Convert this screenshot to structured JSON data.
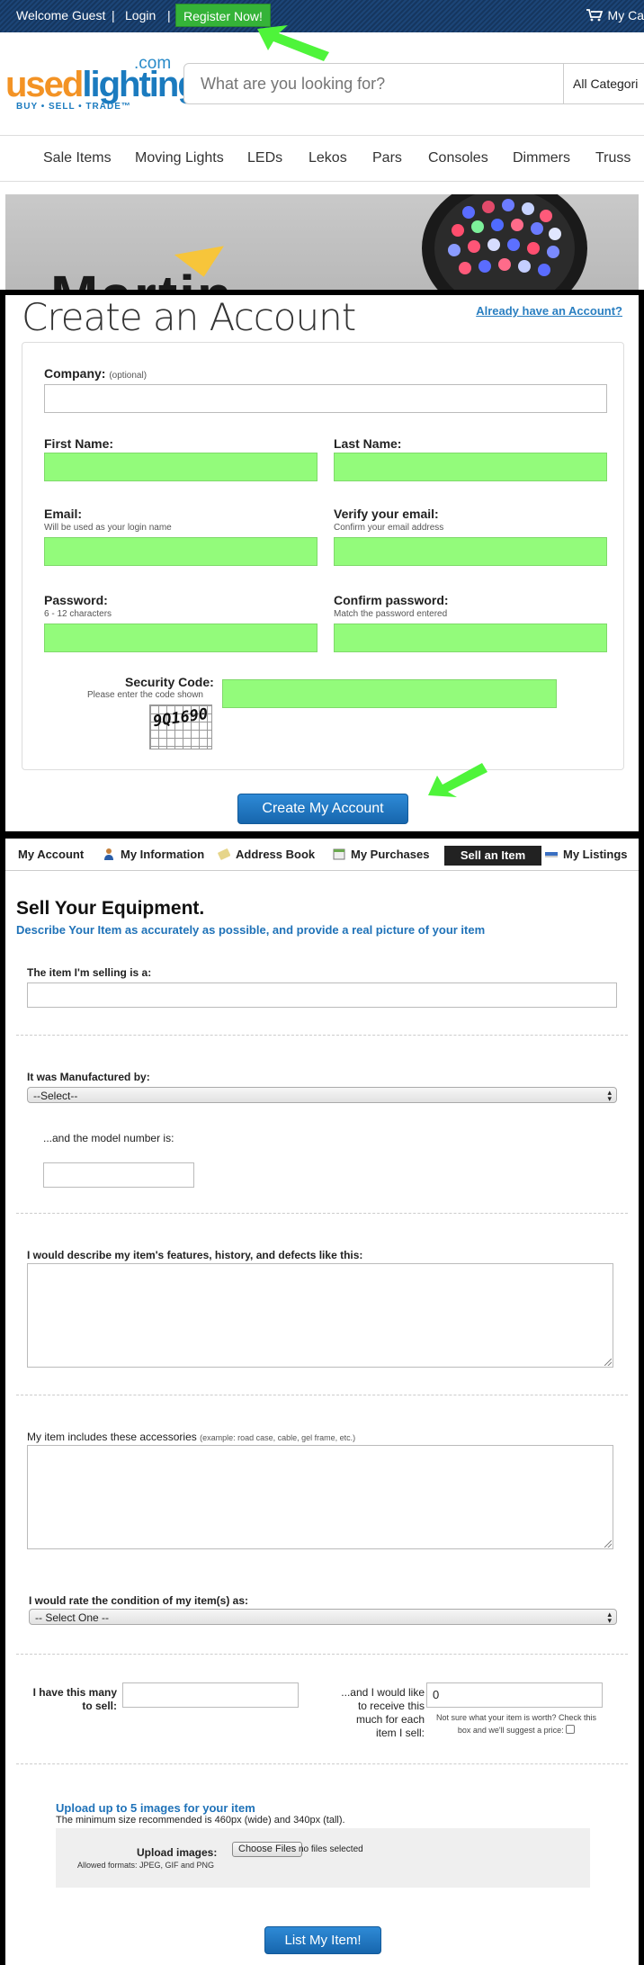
{
  "topbar": {
    "welcome": "Welcome Guest",
    "sep1": "|",
    "login": "Login",
    "sep2": "|",
    "register": "Register Now!",
    "cart": "My Ca"
  },
  "logo": {
    "word1": "used",
    "word2": "lighting",
    "dotcom": ".com",
    "tagline": "BUY • SELL • TRADE™"
  },
  "search": {
    "placeholder": "What are you looking for?",
    "category": "All Categori"
  },
  "nav": {
    "items": [
      "Sale Items",
      "Moving Lights",
      "LEDs",
      "Lekos",
      "Pars",
      "Consoles",
      "Dimmers",
      "Truss"
    ]
  },
  "hero": {
    "brand": "Martin"
  },
  "create_account": {
    "title": "Create an Account",
    "already_link": "Already have an Account?",
    "company_label": "Company:",
    "company_optional": "(optional)",
    "first_name_label": "First Name:",
    "last_name_label": "Last Name:",
    "email_label": "Email:",
    "email_sub": "Will be used as your login name",
    "verify_email_label": "Verify your email:",
    "verify_email_sub": "Confirm your email address",
    "password_label": "Password:",
    "password_sub": "6 - 12 characters",
    "confirm_password_label": "Confirm password:",
    "confirm_password_sub": "Match the password entered",
    "security_label": "Security Code:",
    "security_sub": "Please enter the code shown",
    "captcha": "9Q1690",
    "submit": "Create My Account",
    "highlight_color": "#93fb7b"
  },
  "account_nav": {
    "my_account": "My Account",
    "my_information": "My Information",
    "address_book": "Address Book",
    "my_purchases": "My Purchases",
    "sell_an_item": "Sell an Item",
    "my_listings": "My Listings"
  },
  "sell": {
    "title": "Sell Your Equipment.",
    "subtitle": "Describe Your Item as accurately as possible, and provide a real picture of your item",
    "item_label": "The item I'm selling is a:",
    "manufacturer_label": "It was Manufactured by:",
    "manufacturer_selected": "--Select--",
    "model_label": "...and the model number is:",
    "describe_label": "I would describe my item's features, history, and defects like this:",
    "accessories_label": "My item includes these accessories",
    "accessories_example": "(example: road case, cable, gel frame, etc.)",
    "condition_label": "I would rate the condition of my item(s) as:",
    "condition_selected": "-- Select One --",
    "quantity_label_1": "I have this many",
    "quantity_label_2": "to sell:",
    "price_label_1": "...and I would like",
    "price_label_2": "to receive this",
    "price_label_3": "much for each",
    "price_label_4": "item I sell:",
    "price_value": "0",
    "price_note_1": "Not sure what your item is worth? Check this",
    "price_note_2": "box and we'll suggest a price:",
    "upload_title": "Upload up to 5 images for your item",
    "upload_sub": "The minimum size recommended is 460px (wide) and 340px (tall).",
    "upload_label": "Upload images:",
    "upload_formats": "Allowed formats: JPEG, GIF and PNG",
    "choose_files": "Choose Files",
    "no_files": "no files selected",
    "submit": "List My Item!"
  },
  "colors": {
    "accent_blue": "#1f72b8",
    "button_blue": "#1f78c4",
    "register_green": "#35b338",
    "arrow_green": "#4ef43a"
  }
}
